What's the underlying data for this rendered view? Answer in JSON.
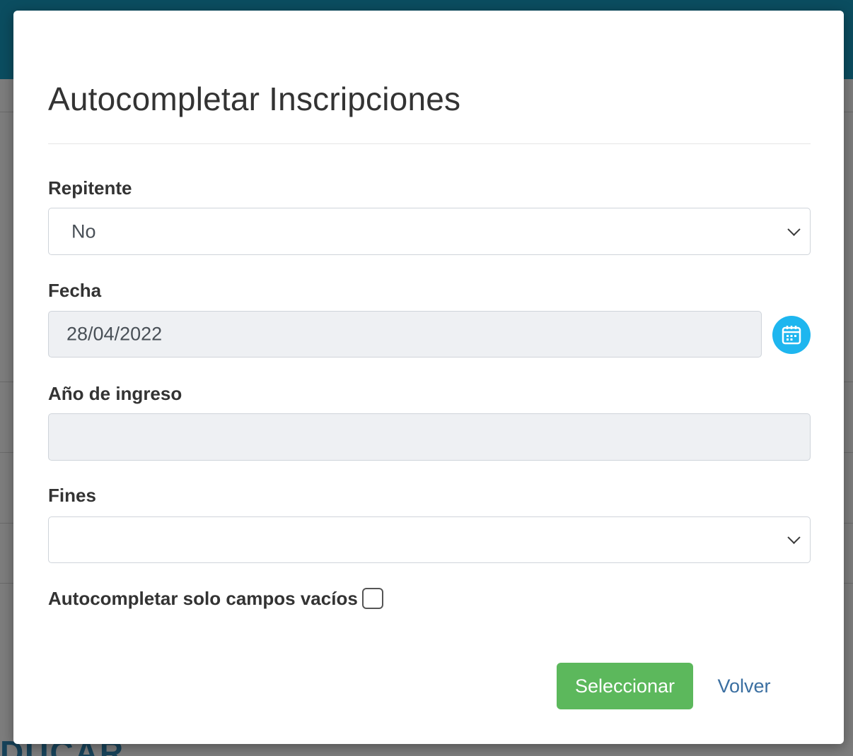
{
  "modal": {
    "title": "Autocompletar Inscripciones"
  },
  "form": {
    "repitente": {
      "label": "Repitente",
      "value": "No"
    },
    "fecha": {
      "label": "Fecha",
      "value": "28/04/2022",
      "icon": "calendar-icon"
    },
    "anio_ingreso": {
      "label": "Año de ingreso",
      "value": ""
    },
    "fines": {
      "label": "Fines",
      "value": ""
    },
    "solo_vacios": {
      "label": "Autocompletar solo campos vacíos",
      "checked": false
    }
  },
  "actions": {
    "select_label": "Seleccionar",
    "back_label": "Volver"
  },
  "colors": {
    "header": "#0b4d60",
    "primary_button": "#5cb85c",
    "calendar_button": "#1eb6ef",
    "link": "#3b6fa1"
  }
}
